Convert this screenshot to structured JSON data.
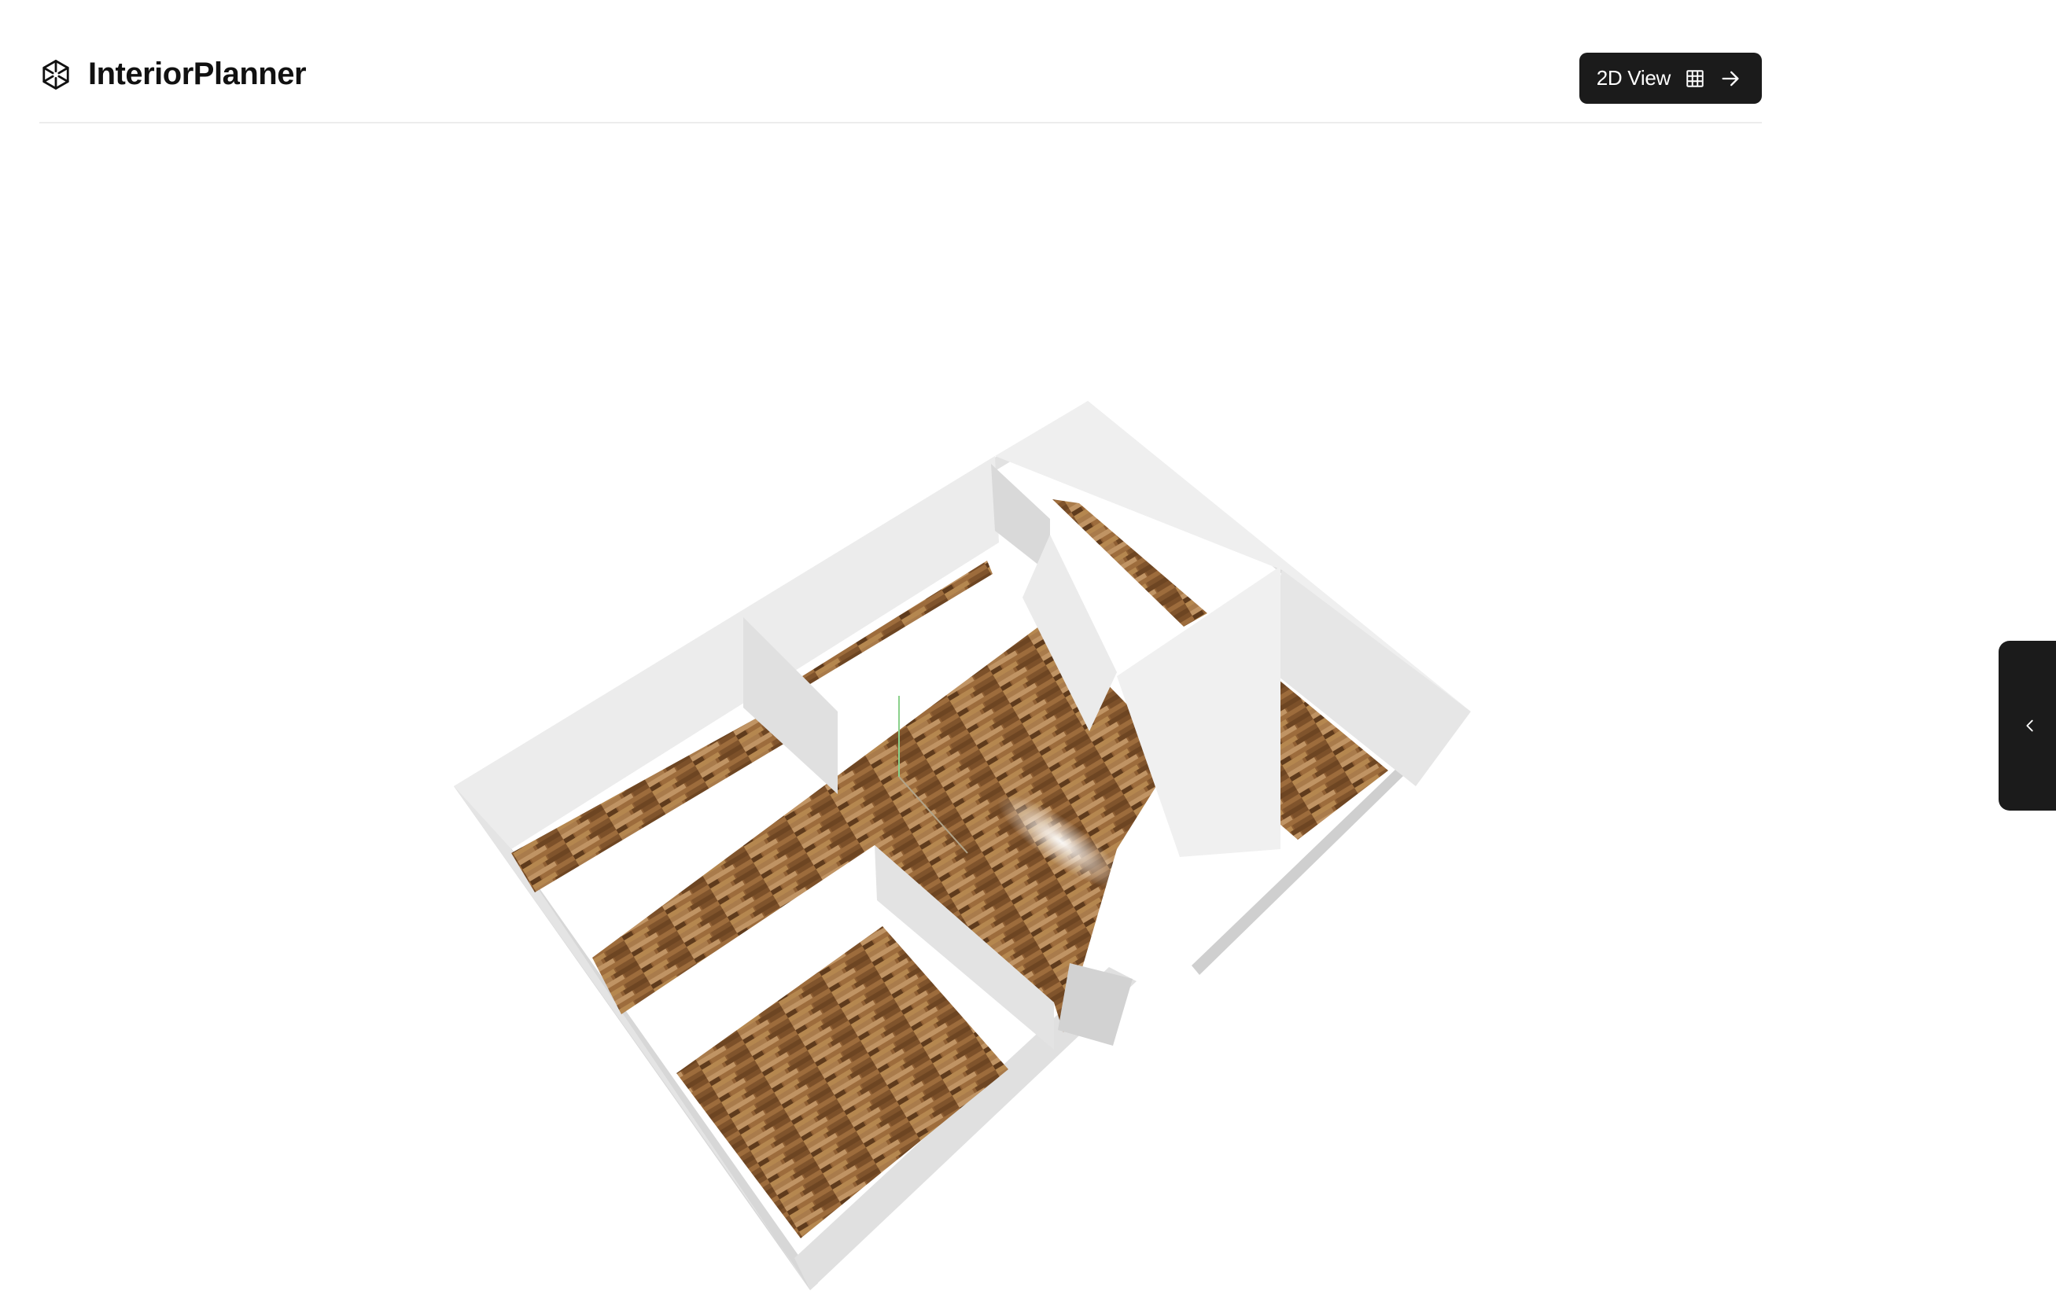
{
  "app": {
    "title": "InteriorPlanner",
    "logo_icon": "cube-logo-icon"
  },
  "toolbar": {
    "view_toggle_label": "2D View",
    "view_toggle_icons": [
      "grid-icon",
      "arrow-right-icon"
    ]
  },
  "viewport": {
    "scene": "3d-floor-plan",
    "floor_colors": [
      "#8a5a2e",
      "#a87a4a",
      "#c49a66",
      "#6d4522"
    ],
    "wall_color": "#e8e8e8"
  },
  "side_panel": {
    "toggle_icon": "chevron-left-icon"
  }
}
